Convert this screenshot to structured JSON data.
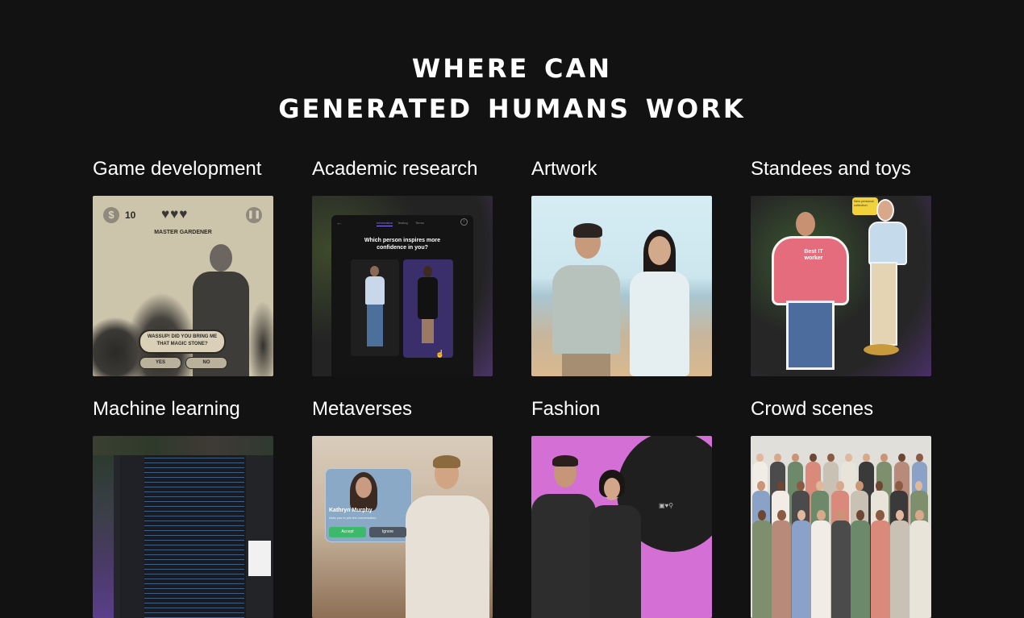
{
  "headline": {
    "line1": "where can",
    "line2": "generated humans work"
  },
  "cards": [
    {
      "label": "Game development",
      "game": {
        "coins": "10",
        "title": "MASTER GARDENER",
        "dialog": "WASSUP! DID YOU BRING ME THAT MAGIC STONE?",
        "yes": "YES",
        "no": "NO",
        "coin_symbol": "$"
      }
    },
    {
      "label": "Academic research",
      "app": {
        "tabs": [
          "Information",
          "Testing",
          "Terms"
        ],
        "question": "Which person inspires more confidence in you?"
      }
    },
    {
      "label": "Artwork"
    },
    {
      "label": "Standees and toys",
      "tag": "Best IT worker",
      "bubble": "New personal collection"
    },
    {
      "label": "Machine learning"
    },
    {
      "label": "Metaverses",
      "call": {
        "name": "Kathryn Murphy",
        "text": "Asks you to join the conversation",
        "accept": "Accept",
        "ignore": "Ignore"
      }
    },
    {
      "label": "Fashion"
    },
    {
      "label": "Crowd scenes"
    }
  ]
}
